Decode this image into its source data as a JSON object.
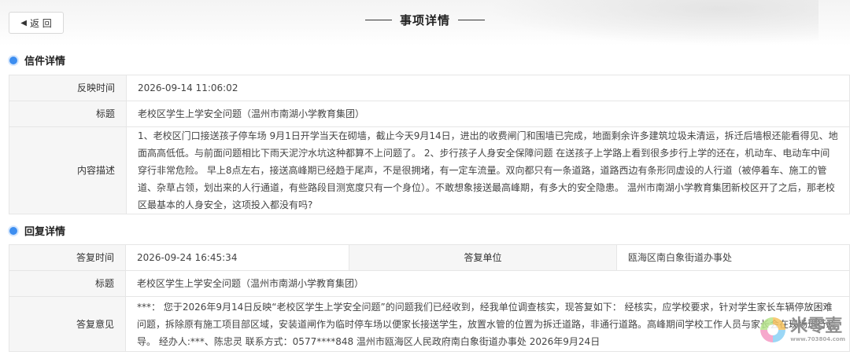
{
  "header": {
    "back_label": "返 回",
    "title": "事项详情"
  },
  "letter": {
    "section_title": "信件详情",
    "rows": [
      {
        "label": "反映时间",
        "value": "2026-09-14 11:06:02"
      },
      {
        "label": "标题",
        "value": "老校区学生上学安全问题（温州市南湖小学教育集团）"
      },
      {
        "label": "内容描述",
        "value": "1、老校区门口接送孩子停车场 9月1日开学当天在砌墙，截止今天9月14日，进出的收费闸门和围墙已完成，地面剩余许多建筑垃圾未清运，拆迁后墙根还能看得见、地面高高低低。与前面问题相比下雨天泥泞水坑这种都算不上问题了。 2、步行孩子人身安全保障问题 在送孩子上学路上看到很多步行上学的还在，机动车、电动车中间穿行非常危险。 早上8点左右，接送高峰期已经趋于尾声，不是很拥堵，有一定车流量。双向都只有一条道路，道路西边有条形同虚设的人行道（被停着车、施工的管道、杂草占领，划出来的人行通道，有些路段目测宽度只有一个身位）。不敢想象接送最高峰期，有多大的安全隐患。 温州市南湖小学教育集团新校区开了之后，那老校区最基本的人身安全，这项投入都没有吗?"
      }
    ]
  },
  "reply": {
    "section_title": "回复详情",
    "time_label": "答复时间",
    "time_value": "2026-09-24 16:45:34",
    "unit_label": "答复单位",
    "unit_value": "瓯海区南白象街道办事处",
    "title_label": "标题",
    "title_value": "老校区学生上学安全问题（温州市南湖小学教育集团）",
    "opinion_label": "答复意见",
    "opinion_value": "***：  您于2026年9月14日反映“老校区学生上学安全问题”的问题我们已经收到，经我单位调查核实，现答复如下：  经核实，应学校要求，针对学生家长车辆停放困难问题，拆除原有施工项目部区域，安装道闸作为临时停车场以便家长接送学生，放置水管的位置为拆迁道路，非通行道路。高峰期间学校工作人员与家长会在现场进行疏导。  经办人:***、陈忠灵 联系方式：0577****848 温州市瓯海区人民政府南白象街道办事处 2026年9月24日"
  },
  "watermark": {
    "text": "米零壹",
    "url": "www.703804.com"
  }
}
